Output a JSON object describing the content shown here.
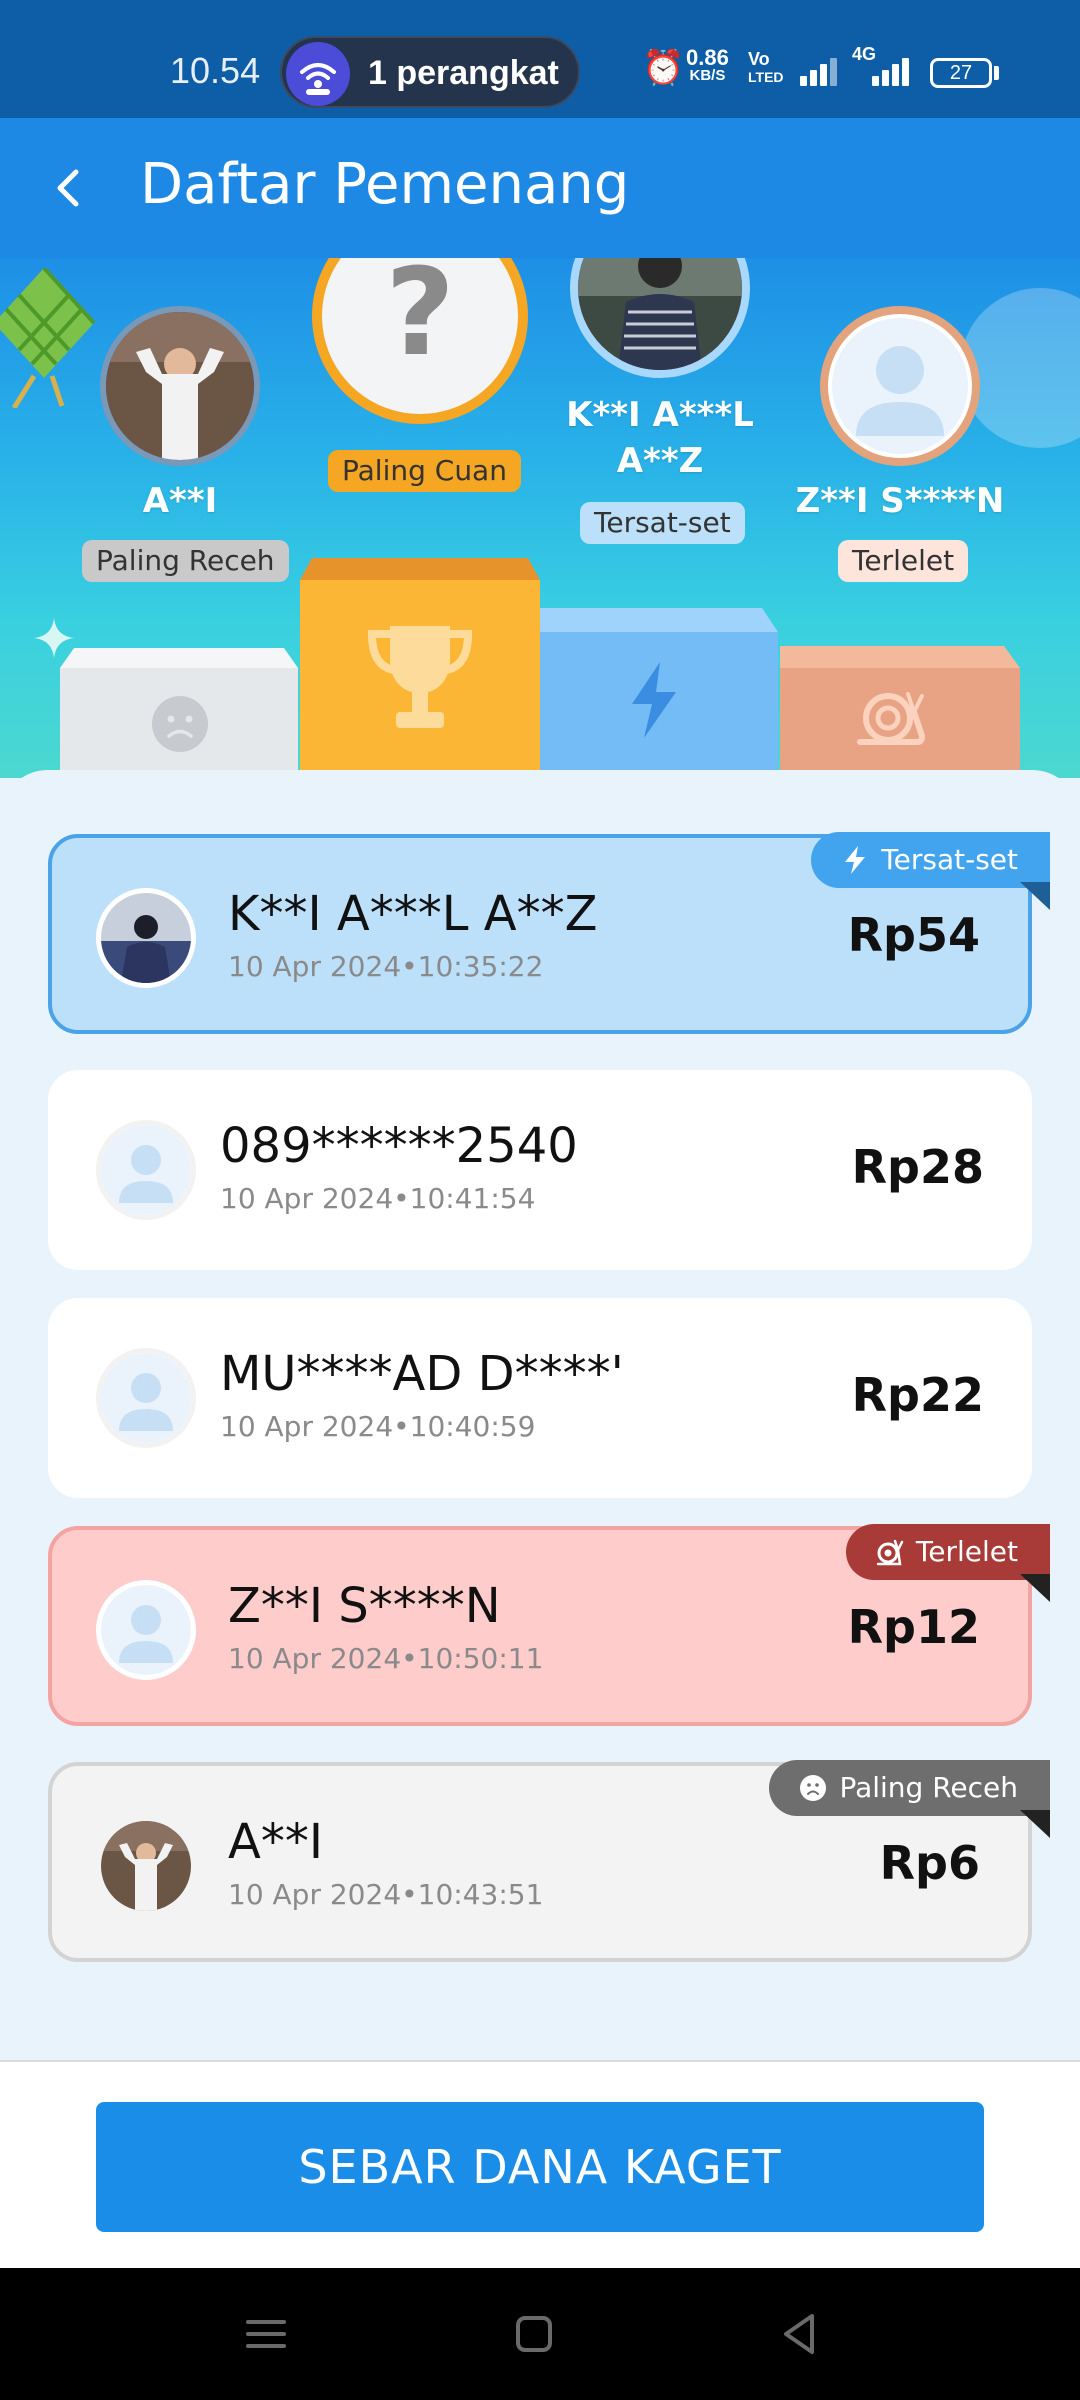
{
  "status_bar": {
    "time": "10.54",
    "hotspot_text": "1 perangkat",
    "speed_value": "0.86",
    "speed_unit": "KB/S",
    "volte_top": "Vo",
    "volte_bottom": "LTED",
    "network": "4G",
    "battery": "27"
  },
  "header": {
    "title": "Daftar Pemenang"
  },
  "podium": {
    "first": {
      "name": "?",
      "tag": "Paling Cuan"
    },
    "left": {
      "name": "A**I",
      "tag": "Paling Receh"
    },
    "middle": {
      "name_line1": "K**I A***L",
      "name_line2": "A**Z",
      "tag": "Tersat-set"
    },
    "right": {
      "name": "Z**I S****N",
      "tag": "Terlelet"
    }
  },
  "winners": [
    {
      "name": "K**I A***L A**Z",
      "time": "10 Apr 2024•10:35:22",
      "amount": "Rp54",
      "badge": "Tersat-set"
    },
    {
      "name": "089******2540",
      "time": "10 Apr 2024•10:41:54",
      "amount": "Rp28"
    },
    {
      "name": "MU****AD D****'",
      "time": "10 Apr 2024•10:40:59",
      "amount": "Rp22"
    },
    {
      "name": "Z**I S****N",
      "time": "10 Apr 2024•10:50:11",
      "amount": "Rp12",
      "badge": "Terlelet"
    },
    {
      "name": "A**I",
      "time": "10 Apr 2024•10:43:51",
      "amount": "Rp6",
      "badge": "Paling Receh"
    }
  ],
  "cta": {
    "label": "SEBAR DANA KAGET"
  },
  "colors": {
    "header": "#1e88e5",
    "status_bar": "#0d5ea6",
    "gold": "#f5a623",
    "fast_blue": "#4aa3e8",
    "slow_red": "#a83a38",
    "receh_grey": "#6e6e6e",
    "cta": "#1a8de9"
  },
  "icons": {
    "back": "chevron-left-icon",
    "trophy": "trophy-icon",
    "lightning": "lightning-icon",
    "snail": "snail-icon",
    "sad": "sad-face-icon"
  }
}
